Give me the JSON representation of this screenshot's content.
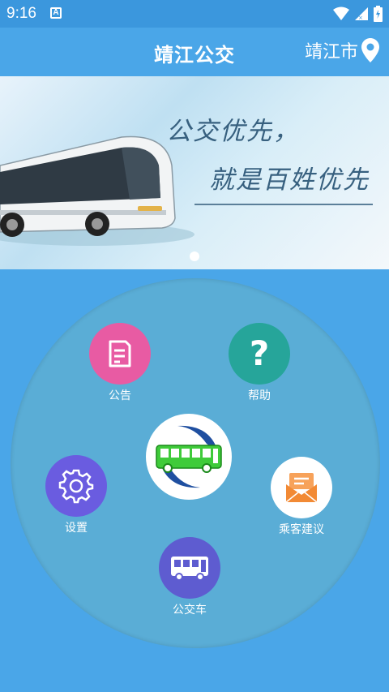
{
  "status_bar": {
    "time": "9:16",
    "a_icon": "A"
  },
  "app_bar": {
    "title": "靖江公交",
    "city": "靖江市"
  },
  "banner": {
    "slogan_line1": "公交优先，",
    "slogan_line2": "就是百姓优先"
  },
  "menu": {
    "announcement": {
      "label": "公告",
      "color": "#e85ba3"
    },
    "help": {
      "label": "帮助",
      "color": "#26a59a"
    },
    "settings": {
      "label": "设置",
      "color": "#6a5ce0"
    },
    "suggestion": {
      "label": "乘客建议",
      "color": "#ffffff"
    },
    "bus": {
      "label": "公交车",
      "color": "#5e5cd0"
    }
  },
  "icons": [
    "wifi-icon",
    "signal-icon",
    "battery-icon",
    "location-pin-icon",
    "document-icon",
    "question-icon",
    "gear-icon",
    "mail-icon",
    "bus-icon"
  ]
}
